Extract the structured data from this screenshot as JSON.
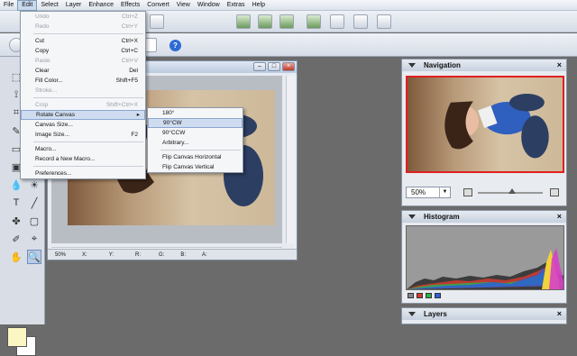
{
  "menubar": [
    "File",
    "Edit",
    "Select",
    "Layer",
    "Enhance",
    "Effects",
    "Convert",
    "View",
    "Window",
    "Extras",
    "Help"
  ],
  "menubar_active": "Edit",
  "edit_menu": [
    {
      "label": "Undo",
      "shortcut": "Ctrl+Z",
      "disabled": true
    },
    {
      "label": "Redo",
      "shortcut": "Ctrl+Y",
      "disabled": true
    },
    {
      "sep": true
    },
    {
      "label": "Cut",
      "shortcut": "Ctrl+X"
    },
    {
      "label": "Copy",
      "shortcut": "Ctrl+C"
    },
    {
      "label": "Paste",
      "shortcut": "Ctrl+V",
      "disabled": true
    },
    {
      "label": "Clear",
      "shortcut": "Del"
    },
    {
      "label": "Fill Color...",
      "shortcut": "Shift+F5"
    },
    {
      "label": "Stroke...",
      "disabled": true
    },
    {
      "sep": true
    },
    {
      "label": "Crop",
      "shortcut": "Shift+Ctrl+X",
      "disabled": true
    },
    {
      "label": "Rotate Canvas",
      "submenu": true,
      "highlighted": true
    },
    {
      "label": "Canvas Size..."
    },
    {
      "label": "Image Size...",
      "shortcut": "F2"
    },
    {
      "sep": true
    },
    {
      "label": "Macro..."
    },
    {
      "label": "Record a New Macro..."
    },
    {
      "sep": true
    },
    {
      "label": "Preferences..."
    }
  ],
  "rotate_submenu": [
    {
      "label": "180°"
    },
    {
      "label": "90°CW",
      "highlighted": true
    },
    {
      "label": "90°CCW"
    },
    {
      "label": "Arbitrary..."
    },
    {
      "sep": true
    },
    {
      "label": "Flip Canvas Horizontal"
    },
    {
      "label": "Flip Canvas Vertical"
    }
  ],
  "document": {
    "status": {
      "zoom": "50%",
      "x": "X:",
      "y": "Y:",
      "r": "R:",
      "g": "G:",
      "b": "B:",
      "a": "A:"
    }
  },
  "navigation": {
    "title": "Navigation",
    "zoom_value": "50%"
  },
  "histogram": {
    "title": "Histogram"
  },
  "layers": {
    "title": "Layers"
  },
  "help_icon": "?",
  "colors": {
    "foreground": "#fbf6c2",
    "background": "#ffffff",
    "nav_border": "#e02020"
  }
}
